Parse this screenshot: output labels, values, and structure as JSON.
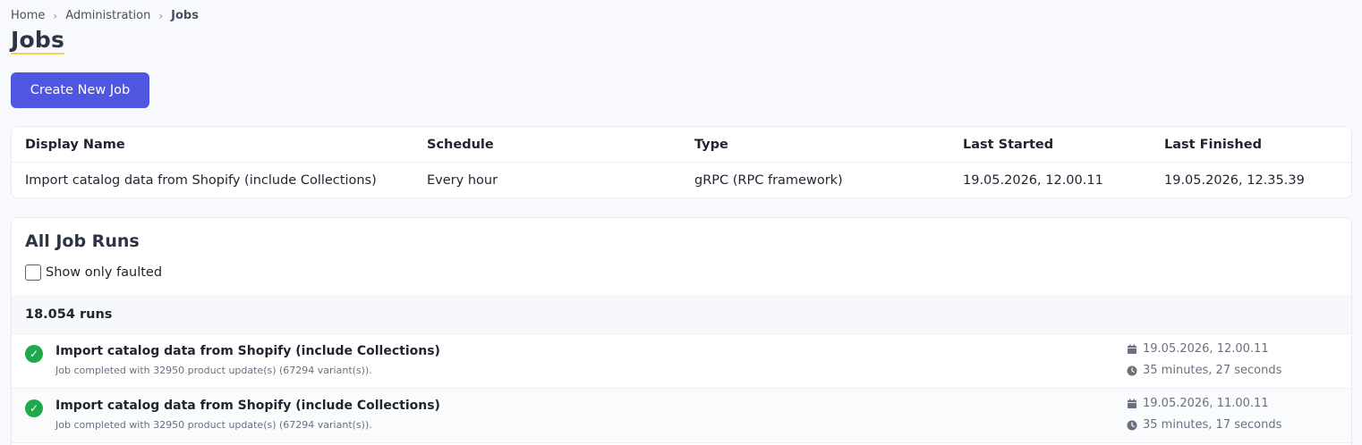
{
  "breadcrumb": {
    "home": "Home",
    "admin": "Administration",
    "current": "Jobs",
    "sep": "›"
  },
  "page": {
    "title": "Jobs",
    "create_button": "Create New Job"
  },
  "jobs_table": {
    "headers": [
      "Display Name",
      "Schedule",
      "Type",
      "Last Started",
      "Last Finished"
    ],
    "rows": [
      [
        "Import catalog data from Shopify (include Collections)",
        "Every hour",
        "gRPC (RPC framework)",
        "19.05.2026, 12.00.11",
        "19.05.2026, 12.35.39"
      ]
    ]
  },
  "runs": {
    "title": "All Job Runs",
    "filter_label": "Show only faulted",
    "count_label": "18.054 runs",
    "items": [
      {
        "name": "Import catalog data from Shopify (include Collections)",
        "desc": "Job completed with 32950 product update(s) (67294 variant(s)).",
        "date": "19.05.2026, 12.00.11",
        "duration": "35 minutes, 27 seconds",
        "status_icon": "check-circle-icon"
      },
      {
        "name": "Import catalog data from Shopify (include Collections)",
        "desc": "Job completed with 32950 product update(s) (67294 variant(s)).",
        "date": "19.05.2026, 11.00.11",
        "duration": "35 minutes, 17 seconds",
        "status_icon": "check-circle-icon"
      }
    ]
  },
  "colors": {
    "accent": "#4f56e0",
    "success": "#20a94a",
    "title_underline": "#f2d34a"
  }
}
